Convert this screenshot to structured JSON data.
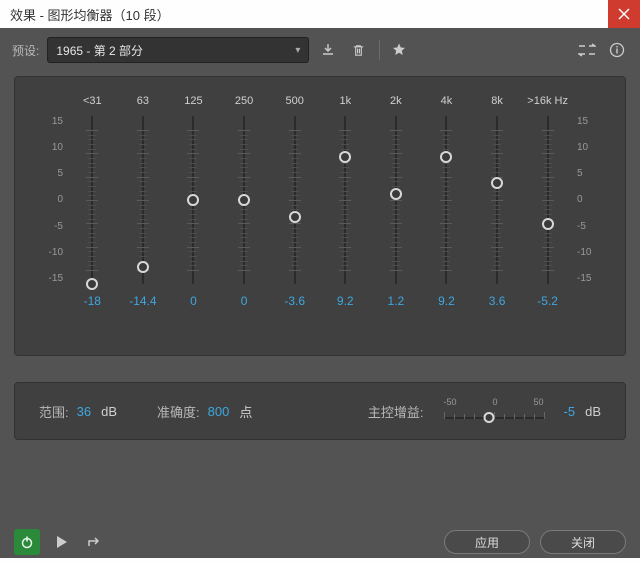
{
  "window": {
    "title": "效果 - 图形均衡器（10 段）"
  },
  "toolbar": {
    "preset_label": "预设:",
    "preset_value": "1965 - 第 2 部分"
  },
  "eq": {
    "range_db": 18,
    "scale_ticks": [
      "15",
      "10",
      "5",
      "0",
      "-5",
      "-10",
      "-15"
    ],
    "unit_suffix": "Hz",
    "bands": [
      {
        "freq": "<31",
        "value": -18,
        "display": "-18"
      },
      {
        "freq": "63",
        "value": -14.4,
        "display": "-14.4"
      },
      {
        "freq": "125",
        "value": 0,
        "display": "0"
      },
      {
        "freq": "250",
        "value": 0,
        "display": "0"
      },
      {
        "freq": "500",
        "value": -3.6,
        "display": "-3.6"
      },
      {
        "freq": "1k",
        "value": 9.2,
        "display": "9.2"
      },
      {
        "freq": "2k",
        "value": 1.2,
        "display": "1.2"
      },
      {
        "freq": "4k",
        "value": 9.2,
        "display": "9.2"
      },
      {
        "freq": "8k",
        "value": 3.6,
        "display": "3.6"
      },
      {
        "freq": ">16k",
        "value": -5.2,
        "display": "-5.2"
      }
    ]
  },
  "footer": {
    "range_label": "范围:",
    "range_value": "36",
    "range_unit": "dB",
    "accuracy_label": "准确度:",
    "accuracy_value": "800",
    "accuracy_unit": "点",
    "master_label": "主控增益:",
    "master_scale": {
      "min": "-50",
      "mid": "0",
      "max": "50"
    },
    "master_value": -5,
    "master_display": "-5",
    "master_unit": "dB"
  },
  "buttons": {
    "apply": "应用",
    "close": "关闭"
  }
}
